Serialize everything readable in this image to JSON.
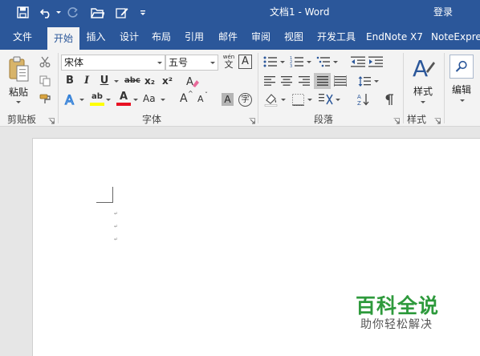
{
  "window": {
    "title": "文档1  -  Word",
    "sign_in": "登录"
  },
  "tabs": [
    {
      "label": "文件"
    },
    {
      "label": "开始",
      "active": true
    },
    {
      "label": "插入"
    },
    {
      "label": "设计"
    },
    {
      "label": "布局"
    },
    {
      "label": "引用"
    },
    {
      "label": "邮件"
    },
    {
      "label": "审阅"
    },
    {
      "label": "视图"
    },
    {
      "label": "开发工具"
    },
    {
      "label": "EndNote X7"
    },
    {
      "label": "NoteExpres"
    }
  ],
  "ribbon": {
    "clipboard": {
      "paste_label": "粘贴",
      "group_label": "剪贴板"
    },
    "font": {
      "font_name": "宋体",
      "font_size": "五号",
      "phonetic_glyph_top": "wén",
      "phonetic_glyph_bottom": "文",
      "border_char": "A",
      "bold": "B",
      "italic": "I",
      "underline": "U",
      "strikethrough": "abc",
      "subscript": "x₂",
      "superscript": "x²",
      "text_effects": "A",
      "highlight": "ab",
      "font_color": "A",
      "change_case": "Aa",
      "grow_font": "A",
      "shrink_font": "A",
      "char_shading": "A",
      "enclose_char": "字",
      "group_label": "字体"
    },
    "paragraph": {
      "group_label": "段落"
    },
    "styles": {
      "styles_label": "样式",
      "group_label": "样式"
    },
    "editing": {
      "edit_label": "编辑"
    }
  },
  "colors": {
    "title_bar": "#2b579a",
    "ribbon_bg": "#f3f3f3",
    "highlight_yellow": "#ffff00",
    "font_color_red": "#e81123",
    "watermark_green": "#2e9a3c"
  },
  "watermark": {
    "title": "百科全说",
    "subtitle": "助你轻松解决"
  }
}
